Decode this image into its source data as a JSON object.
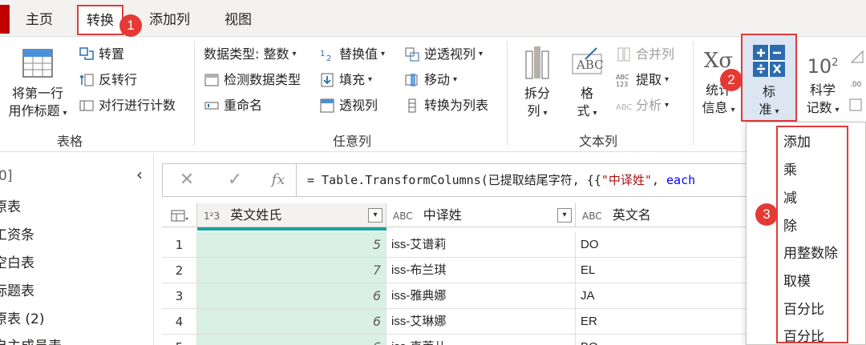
{
  "tabs": [
    {
      "label": "主页"
    },
    {
      "label": "转换"
    },
    {
      "label": "添加列"
    },
    {
      "label": "视图"
    }
  ],
  "callouts": [
    "1",
    "2",
    "3"
  ],
  "groups": {
    "table": {
      "label": "表格",
      "first_row_header": [
        "将第一行",
        "用作标题"
      ],
      "transpose": "转置",
      "reverse_rows": "反转行",
      "count_rows": "对行进行计数"
    },
    "any_column": {
      "label": "任意列",
      "data_type": "数据类型: 整数",
      "detect_type": "检测数据类型",
      "rename": "重命名",
      "replace_values": "替换值",
      "fill": "填充",
      "pivot": "透视列",
      "unpivot": "逆透视列",
      "move": "移动",
      "to_list": "转换为列表"
    },
    "text_column": {
      "label": "文本列",
      "split": [
        "拆分",
        "列"
      ],
      "format": [
        "格",
        "式"
      ],
      "merge": "合并列",
      "extract": "提取",
      "parse": "分析"
    },
    "number_column": {
      "statistics": [
        "统计",
        "信息"
      ],
      "standard": [
        "标",
        "准"
      ],
      "scientific": [
        "科学",
        "记数"
      ]
    }
  },
  "queries": {
    "header_fragment": "0]",
    "items": [
      "原表",
      "工资条",
      "空白表",
      "标题表",
      "原表 (2)",
      "自主成员表"
    ]
  },
  "formula": {
    "prefix": "= Table.TransformColumns(已提取结尾字符, {{",
    "string": "\"中译姓\"",
    "sep": ", ",
    "keyword": "each",
    "fx": "fx"
  },
  "grid": {
    "columns": [
      {
        "type_icon": "1²3",
        "name": "英文姓氏"
      },
      {
        "type_icon": "ABC",
        "name": "中译姓"
      },
      {
        "type_icon": "ABC",
        "name": "英文名"
      }
    ],
    "rows": [
      {
        "idx": "1",
        "a": "5",
        "b": "iss-艾谱莉",
        "c": "DO"
      },
      {
        "idx": "2",
        "a": "7",
        "b": "iss-布兰琪",
        "c": "EL"
      },
      {
        "idx": "3",
        "a": "6",
        "b": "iss-雅典娜",
        "c": "JA"
      },
      {
        "idx": "4",
        "a": "6",
        "b": "iss-艾琳娜",
        "c": "ER"
      },
      {
        "idx": "5",
        "a": "6",
        "b": "iss-克莱儿",
        "c": "BO"
      }
    ]
  },
  "menu": {
    "items": [
      "添加",
      "乘",
      "减",
      "除",
      "用整数除",
      "取模",
      "百分比",
      "百分比"
    ]
  },
  "colors": {
    "accent_red": "#e03a3a",
    "selected_column": "#d8f0e6",
    "teal_bar": "#1aa39a"
  }
}
